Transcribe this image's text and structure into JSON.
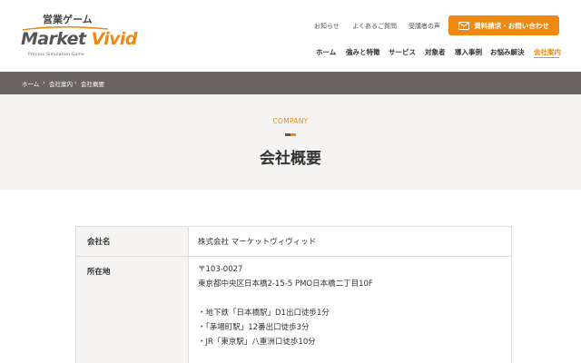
{
  "logo": {
    "top": "営業ゲーム",
    "main_left": "Market",
    "main_right": "Vivid",
    "sub": "Process Simulation Game"
  },
  "util_nav": [
    {
      "label": "お知らせ"
    },
    {
      "label": "よくあるご質問"
    },
    {
      "label": "受講者の声"
    }
  ],
  "cta": {
    "label": "資料請求・お問い合わせ",
    "icon": "mail-icon"
  },
  "main_nav": [
    {
      "label": "ホーム"
    },
    {
      "label": "強みと特徴"
    },
    {
      "label": "サービス"
    },
    {
      "label": "対象者"
    },
    {
      "label": "導入事例"
    },
    {
      "label": "お悩み解決"
    },
    {
      "label": "会社案内"
    }
  ],
  "breadcrumb": [
    "ホーム",
    "会社案内",
    "会社概要"
  ],
  "breadcrumb_sep": "›",
  "hero": {
    "eyebrow": "COMPANY",
    "title": "会社概要"
  },
  "table": {
    "rows": [
      {
        "label": "会社名",
        "value": "株式会社 マーケットヴィヴィッド"
      },
      {
        "label": "所在地",
        "lines": [
          "〒103-0027",
          "東京都中央区日本橋2-15-5 PMO日本橋二丁目10F",
          "",
          "・地下鉄「日本橋駅」D1出口徒歩1分",
          "・「茅場町駅」12番出口徒歩3分",
          "・JR「東京駅」八重洲口徒歩10分"
        ]
      }
    ]
  },
  "colors": {
    "accent": "#ee8a12",
    "breadcrumb_bg": "#6a6462",
    "hero_bg": "#f5f4f2",
    "text": "#333333"
  }
}
